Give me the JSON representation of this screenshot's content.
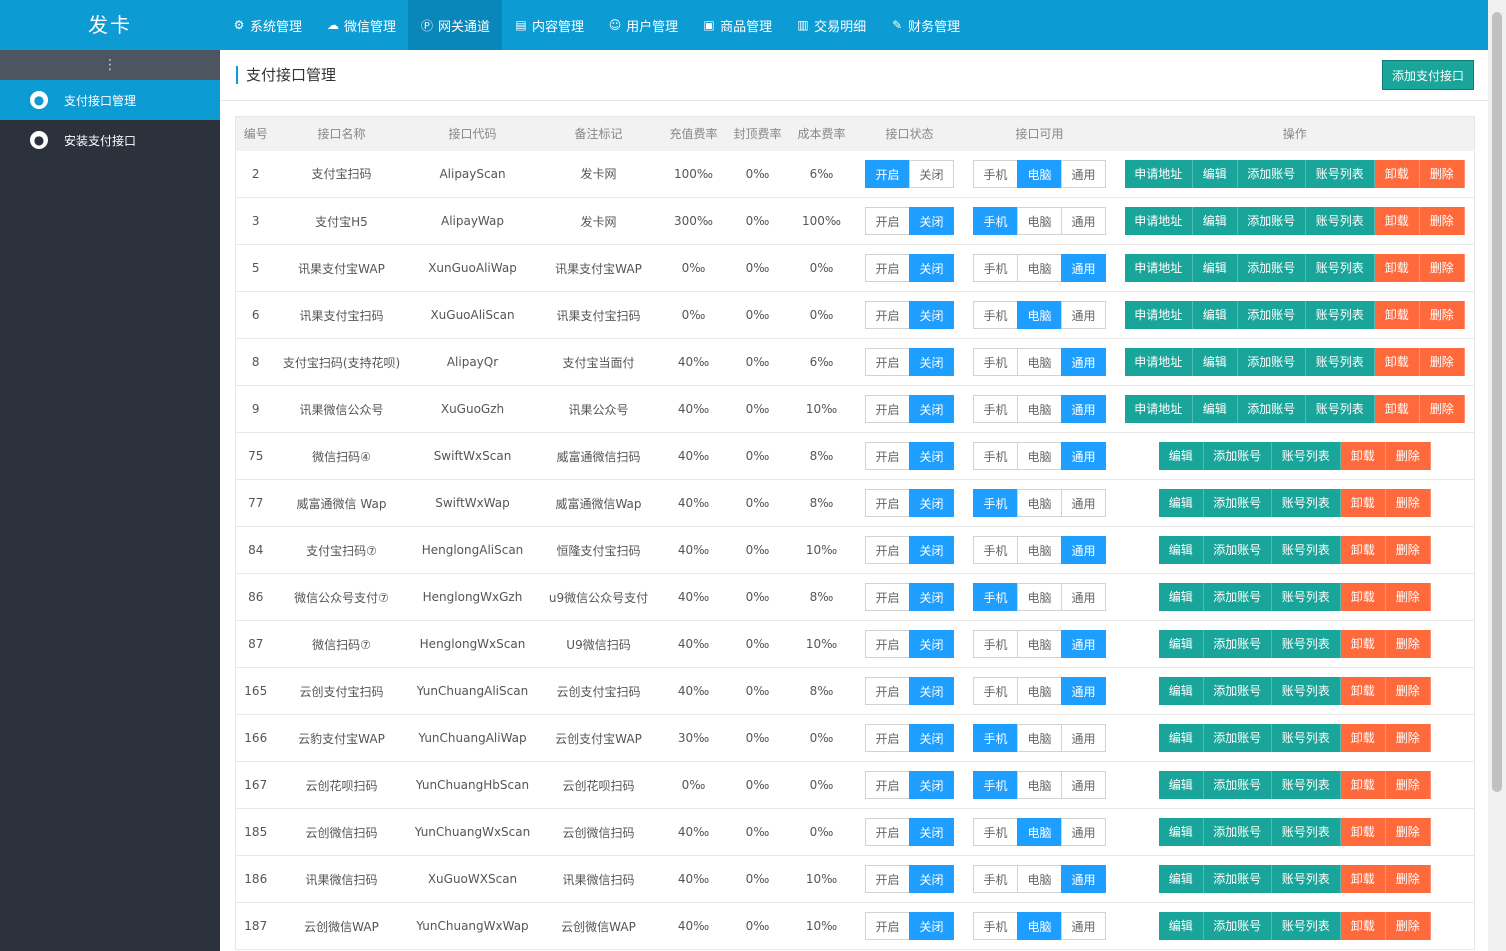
{
  "header": {
    "brand": "发卡",
    "nav": [
      {
        "label": "系统管理",
        "icon": "gear-icon",
        "glyph": "⚙"
      },
      {
        "label": "微信管理",
        "icon": "wechat-icon",
        "glyph": "☁"
      },
      {
        "label": "网关通道",
        "icon": "payment-icon",
        "glyph": "Ⓟ"
      },
      {
        "label": "内容管理",
        "icon": "document-icon",
        "glyph": "▤"
      },
      {
        "label": "用户管理",
        "icon": "users-icon",
        "glyph": "☺"
      },
      {
        "label": "商品管理",
        "icon": "bag-icon",
        "glyph": "▣"
      },
      {
        "label": "交易明细",
        "icon": "chart-icon",
        "glyph": "▥"
      },
      {
        "label": "财务管理",
        "icon": "finance-icon",
        "glyph": "✎"
      }
    ]
  },
  "sidebar": {
    "toggle": "⋮",
    "items": [
      {
        "label": "支付接口管理"
      },
      {
        "label": "安装支付接口"
      }
    ]
  },
  "page": {
    "title": "支付接口管理",
    "add_button": "添加支付接口"
  },
  "table": {
    "headers": [
      "编号",
      "接口名称",
      "接口代码",
      "备注标记",
      "充值费率",
      "封顶费率",
      "成本费率",
      "接口状态",
      "接口可用",
      "操作"
    ],
    "status_labels": [
      "开启",
      "关闭"
    ],
    "usage_labels": [
      "手机",
      "电脑",
      "通用"
    ],
    "op_labels": {
      "apply": "申请地址",
      "edit": "编辑",
      "add_account": "添加账号",
      "account_list": "账号列表",
      "uninstall": "卸载",
      "delete": "删除"
    },
    "rows": [
      {
        "id": "2",
        "name": "支付宝扫码",
        "code": "AlipayScan",
        "remark": "发卡网",
        "rate": "100‰",
        "cap": "0‰",
        "cost": "6‰",
        "status": "on",
        "usage": "pc",
        "apply": true
      },
      {
        "id": "3",
        "name": "支付宝H5",
        "code": "AlipayWap",
        "remark": "发卡网",
        "rate": "300‰",
        "cap": "0‰",
        "cost": "100‰",
        "status": "off",
        "usage": "mobile",
        "apply": true
      },
      {
        "id": "5",
        "name": "讯果支付宝WAP",
        "code": "XunGuoAliWap",
        "remark": "讯果支付宝WAP",
        "rate": "0‰",
        "cap": "0‰",
        "cost": "0‰",
        "status": "off",
        "usage": "all",
        "apply": true
      },
      {
        "id": "6",
        "name": "讯果支付宝扫码",
        "code": "XuGuoAliScan",
        "remark": "讯果支付宝扫码",
        "rate": "0‰",
        "cap": "0‰",
        "cost": "0‰",
        "status": "off",
        "usage": "pc",
        "apply": true
      },
      {
        "id": "8",
        "name": "支付宝扫码(支持花呗)",
        "code": "AlipayQr",
        "remark": "支付宝当面付",
        "rate": "40‰",
        "cap": "0‰",
        "cost": "6‰",
        "status": "off",
        "usage": "all",
        "apply": true
      },
      {
        "id": "9",
        "name": "讯果微信公众号",
        "code": "XuGuoGzh",
        "remark": "讯果公众号",
        "rate": "40‰",
        "cap": "0‰",
        "cost": "10‰",
        "status": "off",
        "usage": "all",
        "apply": true
      },
      {
        "id": "75",
        "name": "微信扫码④",
        "code": "SwiftWxScan",
        "remark": "威富通微信扫码",
        "rate": "40‰",
        "cap": "0‰",
        "cost": "8‰",
        "status": "off",
        "usage": "all",
        "apply": false
      },
      {
        "id": "77",
        "name": "威富通微信 Wap",
        "code": "SwiftWxWap",
        "remark": "威富通微信Wap",
        "rate": "40‰",
        "cap": "0‰",
        "cost": "8‰",
        "status": "off",
        "usage": "mobile",
        "apply": false
      },
      {
        "id": "84",
        "name": "支付宝扫码⑦",
        "code": "HenglongAliScan",
        "remark": "恒隆支付宝扫码",
        "rate": "40‰",
        "cap": "0‰",
        "cost": "10‰",
        "status": "off",
        "usage": "all",
        "apply": false
      },
      {
        "id": "86",
        "name": "微信公众号支付⑦",
        "code": "HenglongWxGzh",
        "remark": "u9微信公众号支付",
        "rate": "40‰",
        "cap": "0‰",
        "cost": "8‰",
        "status": "off",
        "usage": "mobile",
        "apply": false
      },
      {
        "id": "87",
        "name": "微信扫码⑦",
        "code": "HenglongWxScan",
        "remark": "U9微信扫码",
        "rate": "40‰",
        "cap": "0‰",
        "cost": "10‰",
        "status": "off",
        "usage": "all",
        "apply": false
      },
      {
        "id": "165",
        "name": "云创支付宝扫码",
        "code": "YunChuangAliScan",
        "remark": "云创支付宝扫码",
        "rate": "40‰",
        "cap": "0‰",
        "cost": "8‰",
        "status": "off",
        "usage": "all",
        "apply": false
      },
      {
        "id": "166",
        "name": "云豹支付宝WAP",
        "code": "YunChuangAliWap",
        "remark": "云创支付宝WAP",
        "rate": "30‰",
        "cap": "0‰",
        "cost": "0‰",
        "status": "off",
        "usage": "mobile",
        "apply": false
      },
      {
        "id": "167",
        "name": "云创花呗扫码",
        "code": "YunChuangHbScan",
        "remark": "云创花呗扫码",
        "rate": "0‰",
        "cap": "0‰",
        "cost": "0‰",
        "status": "off",
        "usage": "mobile",
        "apply": false
      },
      {
        "id": "185",
        "name": "云创微信扫码",
        "code": "YunChuangWxScan",
        "remark": "云创微信扫码",
        "rate": "40‰",
        "cap": "0‰",
        "cost": "0‰",
        "status": "off",
        "usage": "pc",
        "apply": false
      },
      {
        "id": "186",
        "name": "讯果微信扫码",
        "code": "XuGuoWXScan",
        "remark": "讯果微信扫码",
        "rate": "40‰",
        "cap": "0‰",
        "cost": "10‰",
        "status": "off",
        "usage": "all",
        "apply": false
      },
      {
        "id": "187",
        "name": "云创微信WAP",
        "code": "YunChuangWxWap",
        "remark": "云创微信WAP",
        "rate": "40‰",
        "cap": "0‰",
        "cost": "10‰",
        "status": "off",
        "usage": "pc",
        "apply": false
      }
    ]
  }
}
